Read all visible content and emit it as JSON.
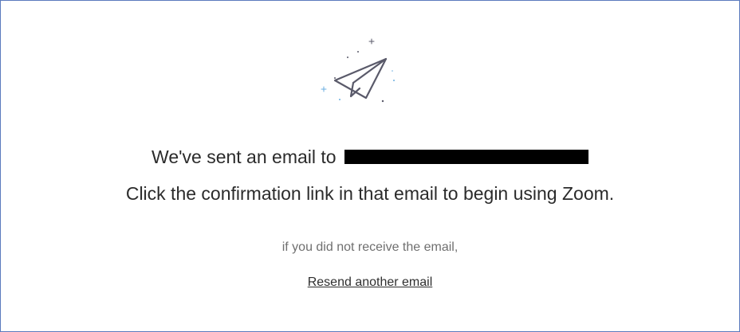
{
  "confirmation": {
    "sent_prefix": "We've sent an email to",
    "instructions": "Click the confirmation link in that email to begin using Zoom.",
    "not_received": "if you did not receive the email,",
    "resend_label": "Resend another email"
  },
  "icons": {
    "hero": "paper-plane-icon"
  },
  "colors": {
    "border": "#5b7bbd",
    "text_primary": "#2b2b2b",
    "text_secondary": "#6f6f6f",
    "icon_stroke": "#5a5a6a",
    "sparkle_blue": "#6aaee0"
  }
}
